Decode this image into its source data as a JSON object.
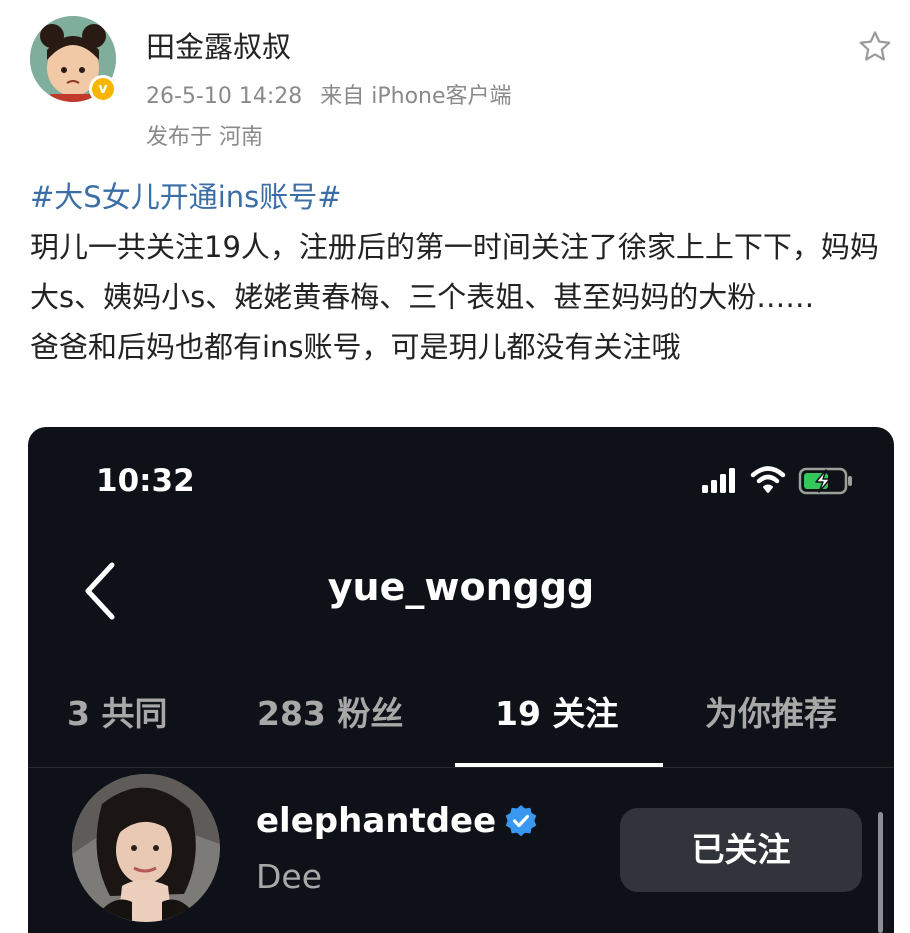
{
  "post": {
    "author": "田金露叔叔",
    "verified_badge": "v",
    "timestamp": "26-5-10 14:28",
    "source": "来自 iPhone客户端",
    "location": "发布于 河南",
    "hashtag": "#大S女儿开通ins账号#",
    "paragraph1": "玥儿一共关注19人，注册后的第一时间关注了徐家上上下下，妈妈大s、姨妈小s、姥姥黄春梅、三个表姐、甚至妈妈的大粉……",
    "paragraph2": "爸爸和后妈也都有ins账号，可是玥儿都没有关注哦",
    "colors": {
      "hashtag": "#3b6ea6",
      "meta": "#8a8a8a",
      "badge": "#f7b500"
    }
  },
  "screenshot": {
    "status_time": "10:32",
    "profile_handle": "yue_wonggg",
    "tabs": [
      {
        "label": "3 共同",
        "active": false
      },
      {
        "label": "283 粉丝",
        "active": false
      },
      {
        "label": "19 关注",
        "active": true
      },
      {
        "label": "为你推荐",
        "active": false
      }
    ],
    "following_list": [
      {
        "username": "elephantdee",
        "display_name": "Dee",
        "verified": true,
        "button_label": "已关注"
      }
    ],
    "colors": {
      "background": "#0e1117",
      "verified": "#3897f0",
      "button": "#31343a"
    },
    "icons": [
      "back-icon",
      "signal-icon",
      "wifi-icon",
      "battery-charging-icon",
      "verified-icon"
    ]
  }
}
